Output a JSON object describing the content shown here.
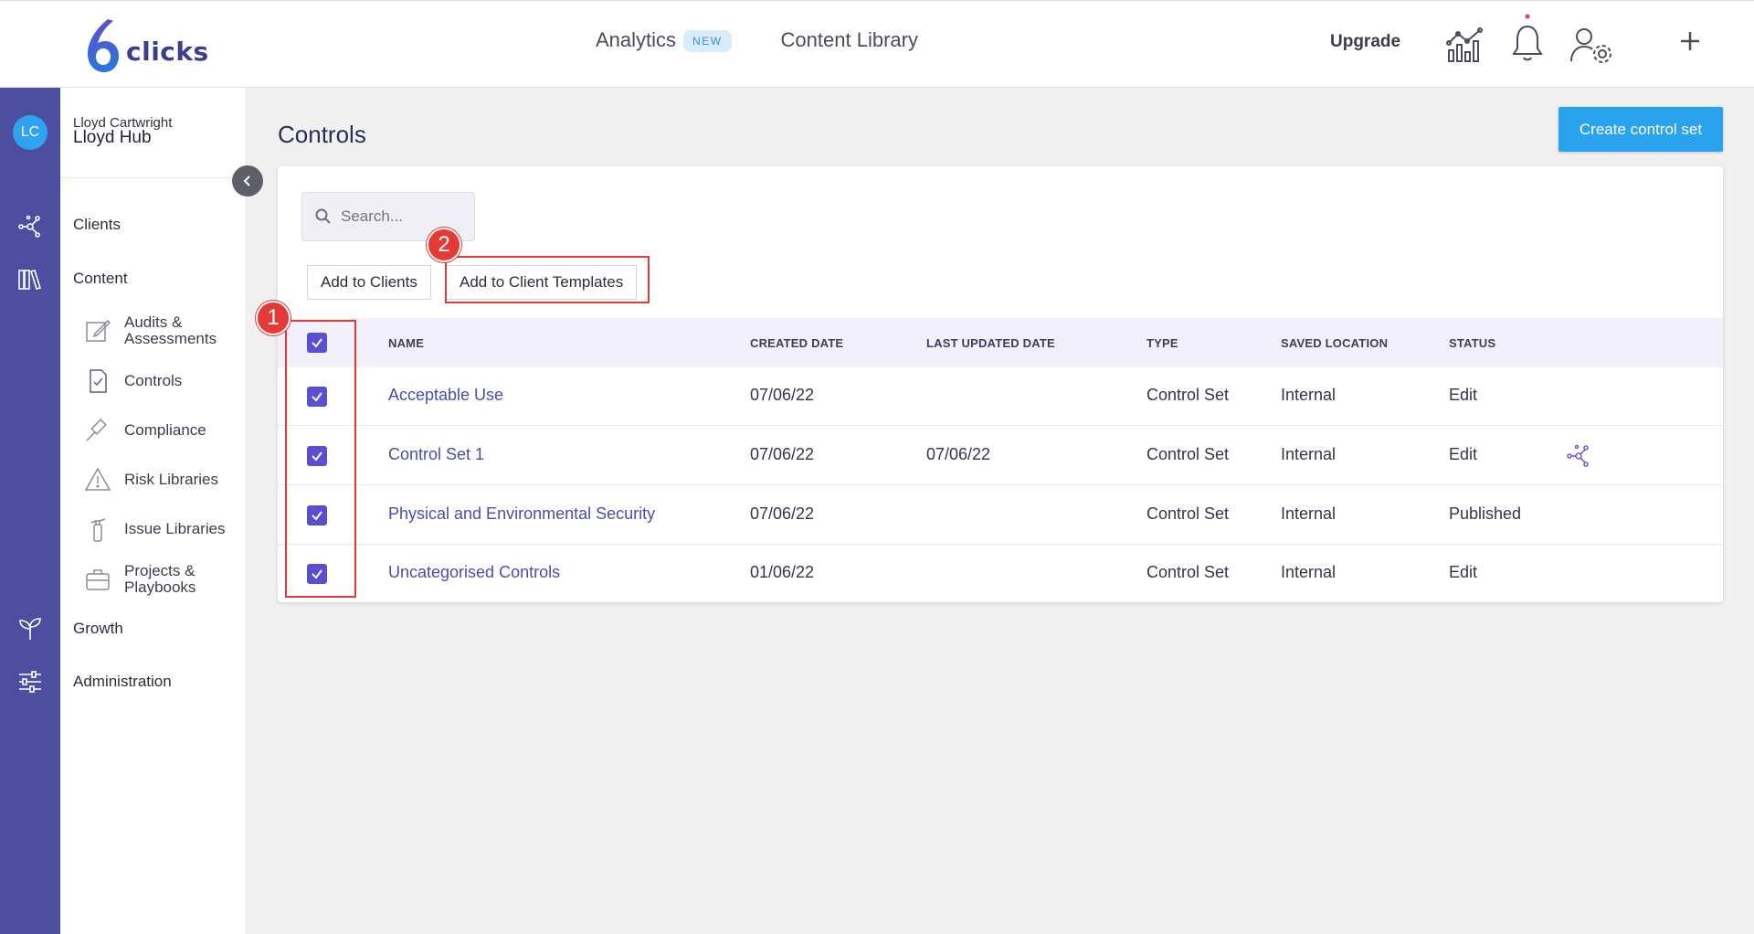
{
  "brand": {
    "logo_text": "clicks",
    "accent": "#4c4fa0"
  },
  "topnav": {
    "analytics_label": "Analytics",
    "analytics_badge": "NEW",
    "content_library_label": "Content Library",
    "upgrade_label": "Upgrade",
    "icons": [
      "analytics-chart-icon",
      "bell-icon",
      "user-settings-icon",
      "plus-icon"
    ]
  },
  "rail": {
    "avatar_initials": "LC",
    "icons": [
      "network-icon",
      "library-icon",
      "sprout-icon",
      "sliders-icon"
    ]
  },
  "sidebar": {
    "user_name": "Lloyd Cartwright",
    "hub_name": "Lloyd Hub",
    "clients_label": "Clients",
    "content_label": "Content",
    "items": [
      {
        "label": "Audits &\nAssessments",
        "icon": "edit-icon"
      },
      {
        "label": "Controls",
        "icon": "checklist-icon"
      },
      {
        "label": "Compliance",
        "icon": "gavel-icon"
      },
      {
        "label": "Risk Libraries",
        "icon": "warning-icon"
      },
      {
        "label": "Issue Libraries",
        "icon": "fire-extinguisher-icon"
      },
      {
        "label": "Projects &\nPlaybooks",
        "icon": "briefcase-icon"
      }
    ],
    "growth_label": "Growth",
    "administration_label": "Administration"
  },
  "main": {
    "title": "Controls",
    "create_button": "Create control set",
    "search_placeholder": "Search...",
    "add_to_clients": "Add to Clients",
    "add_to_client_templates": "Add to Client Templates",
    "columns": [
      "NAME",
      "CREATED DATE",
      "LAST UPDATED DATE",
      "TYPE",
      "SAVED LOCATION",
      "STATUS"
    ],
    "rows": [
      {
        "name": "Acceptable Use",
        "created": "07/06/22",
        "updated": "",
        "type": "Control Set",
        "location": "Internal",
        "status": "Edit",
        "checked": true,
        "shared_icon": false
      },
      {
        "name": "Control Set 1",
        "created": "07/06/22",
        "updated": "07/06/22",
        "type": "Control Set",
        "location": "Internal",
        "status": "Edit",
        "checked": true,
        "shared_icon": true
      },
      {
        "name": "Physical and Environmental Security",
        "created": "07/06/22",
        "updated": "",
        "type": "Control Set",
        "location": "Internal",
        "status": "Published",
        "checked": true,
        "shared_icon": false
      },
      {
        "name": "Uncategorised Controls",
        "created": "01/06/22",
        "updated": "",
        "type": "Control Set",
        "location": "Internal",
        "status": "Edit",
        "checked": true,
        "shared_icon": false
      }
    ]
  },
  "annotations": {
    "step1": "1",
    "step2": "2",
    "color": "#e53935"
  }
}
